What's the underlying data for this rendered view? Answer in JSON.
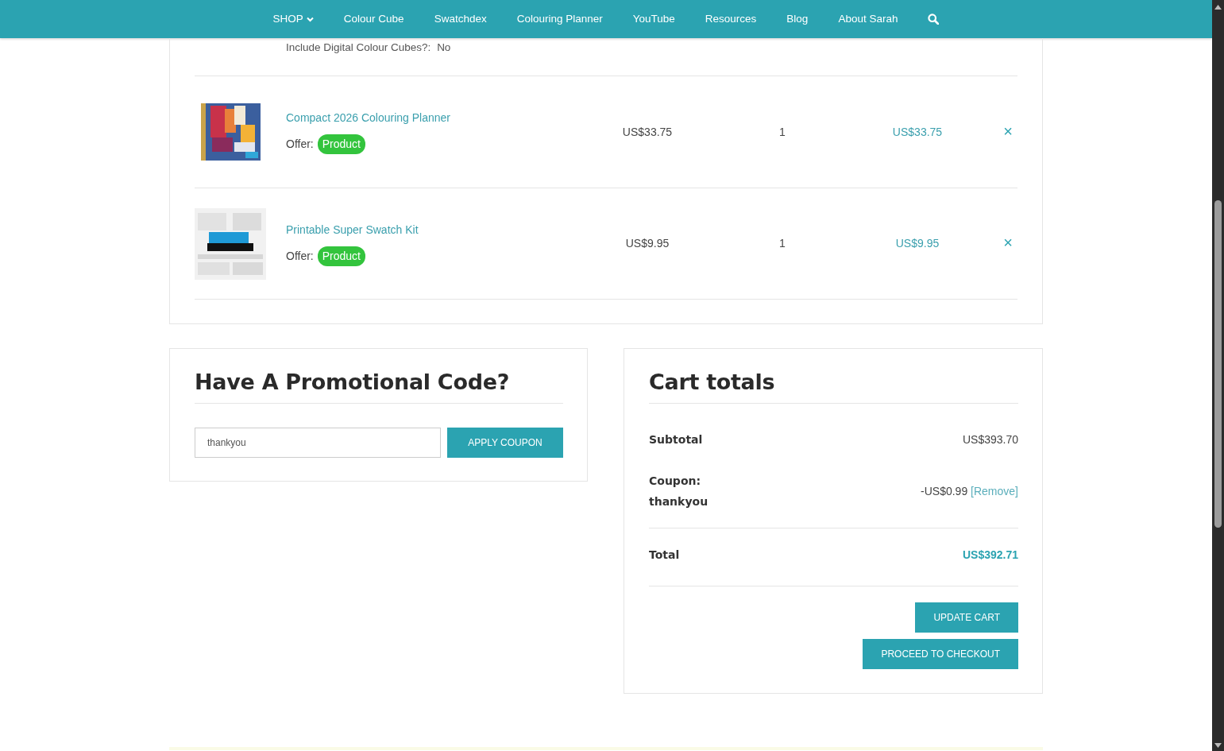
{
  "nav": {
    "items": [
      {
        "label": "SHOP",
        "kind": "dropdown"
      },
      {
        "label": "Colour Cube",
        "kind": "link"
      },
      {
        "label": "Swatchdex",
        "kind": "link"
      },
      {
        "label": "Colouring Planner",
        "kind": "link"
      },
      {
        "label": "YouTube",
        "kind": "link"
      },
      {
        "label": "Resources",
        "kind": "link"
      },
      {
        "label": "Blog",
        "kind": "link"
      },
      {
        "label": "About Sarah",
        "kind": "link"
      }
    ]
  },
  "cart": {
    "partial_row_meta": {
      "label": "Include Digital Colour Cubes?:",
      "value": "No"
    },
    "items": [
      {
        "name": "Compact 2026 Colouring Planner",
        "offer_label": "Offer:",
        "offer_badge": "Product",
        "price": "US$33.75",
        "quantity": "1",
        "subtotal": "US$33.75",
        "remove": "×"
      },
      {
        "name": "Printable Super Swatch Kit",
        "offer_label": "Offer:",
        "offer_badge": "Product",
        "price": "US$9.95",
        "quantity": "1",
        "subtotal": "US$9.95",
        "remove": "×"
      }
    ]
  },
  "promo": {
    "title": "Have A Promotional Code?",
    "coupon_field": {
      "value": "thankyou"
    },
    "apply_button": "APPLY COUPON"
  },
  "totals": {
    "title": "Cart totals",
    "rows": [
      {
        "kind": "subtotal",
        "label": "Subtotal",
        "value": "US$393.70"
      },
      {
        "kind": "coupon",
        "label": "Coupon:",
        "code": "thankyou",
        "value": "-US$0.99",
        "remove_link": "[Remove]"
      },
      {
        "kind": "total",
        "label": "Total",
        "value": "US$392.71"
      }
    ],
    "buttons": [
      "UPDATE CART",
      "PROCEED TO CHECKOUT"
    ]
  }
}
